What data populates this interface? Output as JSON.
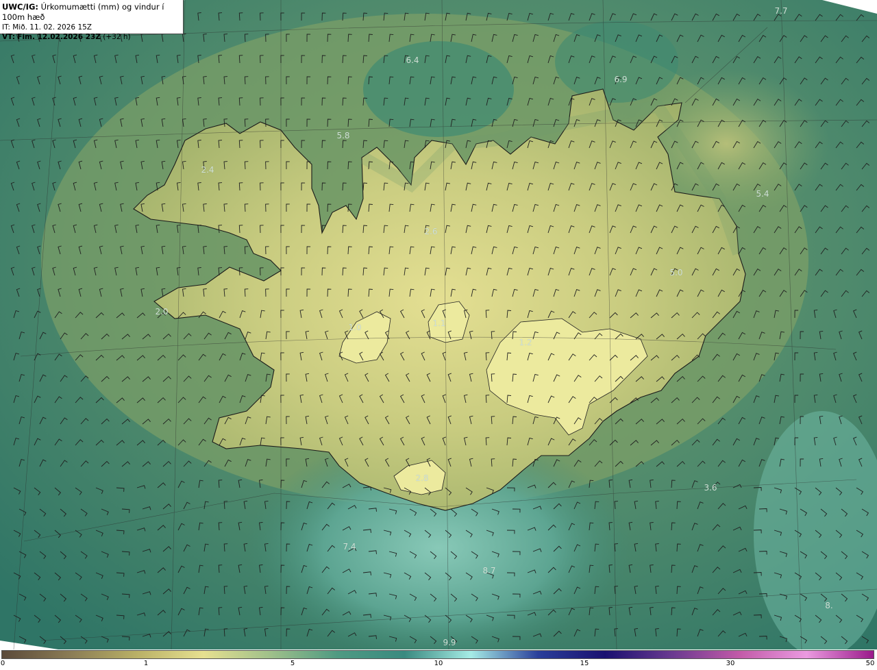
{
  "header": {
    "model": "UWC/IG:",
    "title": "Úrkomumætti (mm) og vindur í 100m hæð",
    "it_line": "IT: Mið. 11. 02. 2026 15Z",
    "vt_prefix": "VT:",
    "vt_bold": "Fim. 12.02.2026 23Z",
    "vt_suffix": "(+32 h)"
  },
  "map_labels": [
    {
      "name": "label-6-4",
      "text": "6.4"
    },
    {
      "name": "label-6-9",
      "text": "6.9"
    },
    {
      "name": "label-5-8",
      "text": "5.8"
    },
    {
      "name": "label-2-4",
      "text": "2.4"
    },
    {
      "name": "label-5-4",
      "text": "5.4"
    },
    {
      "name": "label-2-6",
      "text": "2.6"
    },
    {
      "name": "label-5-0",
      "text": "5.0"
    },
    {
      "name": "label-2-0",
      "text": "2.0"
    },
    {
      "name": "label-1-1",
      "text": "1.1"
    },
    {
      "name": "label-1-0",
      "text": "1.0"
    },
    {
      "name": "label-1-2",
      "text": "1.2"
    },
    {
      "name": "label-2-8",
      "text": "2.8"
    },
    {
      "name": "label-3-6",
      "text": "3.6"
    },
    {
      "name": "label-7-4",
      "text": "7.4"
    },
    {
      "name": "label-8-7",
      "text": "8.7"
    },
    {
      "name": "label-7-7",
      "text": "7.7"
    },
    {
      "name": "label-8-x",
      "text": "8."
    },
    {
      "name": "label-9-9",
      "text": "9.9"
    }
  ],
  "colors": {
    "ocean_deep": "#2c7064",
    "ocean_mid": "#3f8a72",
    "land_low": "#8fa85c",
    "land_high": "#e8e596",
    "coast": "#1a1a1a",
    "barb": "#1f1f1f",
    "label": "#cfe0d6"
  },
  "colorbar": {
    "stops": [
      "#5b4a3a",
      "#8a7b55",
      "#b9b066",
      "#e6e090",
      "#9fc08a",
      "#4f9a82",
      "#3a8a80",
      "#a6ece6",
      "#2a3f9a",
      "#1a1070",
      "#6a3a90",
      "#c25aa8",
      "#ea9ae0",
      "#9a1a8a"
    ],
    "ticks": [
      "0",
      "1",
      "5",
      "10",
      "15",
      "30",
      "50"
    ]
  }
}
